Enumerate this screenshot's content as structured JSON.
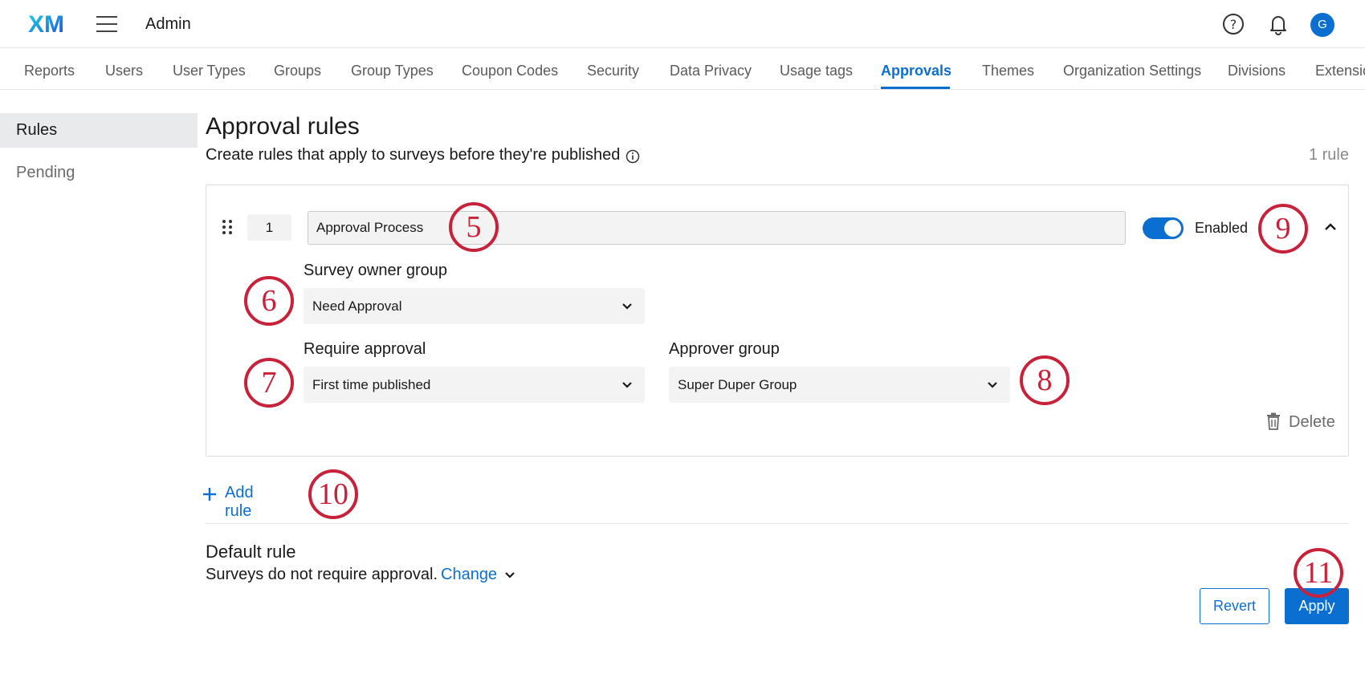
{
  "header": {
    "logo_text": "XM",
    "app_title": "Admin",
    "avatar_initial": "G",
    "icons": [
      "help-icon",
      "bell-icon",
      "menu-icon"
    ]
  },
  "tabs": [
    {
      "label": "Reports"
    },
    {
      "label": "Users"
    },
    {
      "label": "User Types"
    },
    {
      "label": "Groups"
    },
    {
      "label": "Group Types"
    },
    {
      "label": "Coupon Codes"
    },
    {
      "label": "Security"
    },
    {
      "label": "Data Privacy"
    },
    {
      "label": "Usage tags"
    },
    {
      "label": "Approvals",
      "active": true
    },
    {
      "label": "Themes"
    },
    {
      "label": "Organization Settings"
    },
    {
      "label": "Divisions"
    },
    {
      "label": "Extensic"
    }
  ],
  "sidebar": {
    "items": [
      {
        "label": "Rules",
        "active": true
      },
      {
        "label": "Pending"
      }
    ]
  },
  "main": {
    "title": "Approval rules",
    "subtitle": "Create rules that apply to surveys before they're published",
    "rule_count": "1 rule"
  },
  "rule": {
    "number": "1",
    "name": "Approval Process",
    "enabled_label": "Enabled",
    "enabled": true,
    "owner_group_label": "Survey owner group",
    "owner_group_value": "Need Approval",
    "require_label": "Require approval",
    "require_value": "First time published",
    "approver_label": "Approver group",
    "approver_value": "Super Duper Group",
    "delete_label": "Delete"
  },
  "add_rule_label": "Add rule",
  "default_rule": {
    "title": "Default rule",
    "text": "Surveys do not require approval.",
    "change_label": "Change"
  },
  "actions": {
    "revert_label": "Revert",
    "apply_label": "Apply"
  },
  "callouts": [
    "5",
    "6",
    "7",
    "8",
    "9",
    "10",
    "11"
  ],
  "colors": {
    "accent": "#0b6fd1",
    "callout": "#c8213a"
  }
}
